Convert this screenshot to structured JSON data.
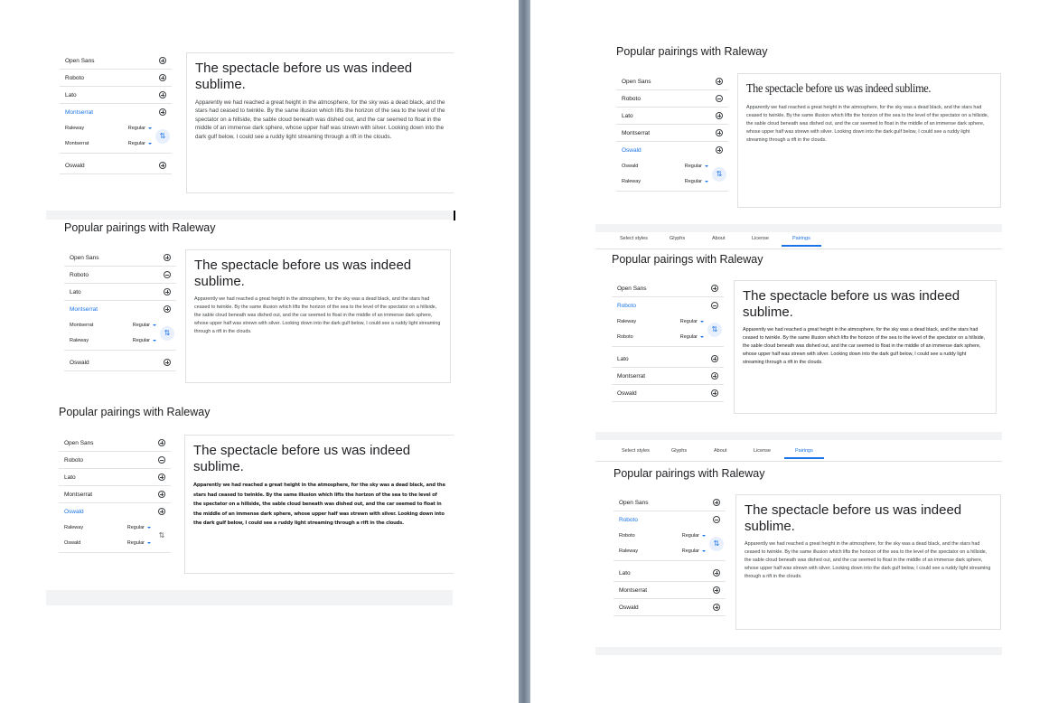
{
  "heading": "Popular pairings with Raleway",
  "preview": {
    "title": "The spectacle before us was indeed sublime.",
    "body": "Apparently we had reached a great height in the atmosphere, for the sky was a dead black, and the stars had ceased to twinkle. By the same illusion which lifts the horizon of the sea to the level of the spectator on a hillside, the sable cloud beneath was dished out, and the car seemed to float in the middle of an immense dark sphere, whose upper half was strewn with silver. Looking down into the dark gulf below, I could see a ruddy light streaming through a rift in the clouds."
  },
  "style_label": "Regular",
  "tabs": [
    "Select styles",
    "Glyphs",
    "About",
    "License",
    "Pairings"
  ],
  "active_tab": "Pairings",
  "panels": [
    {
      "fonts_before": [
        "Open Sans",
        "Roboto",
        "Lato",
        "Montserrat"
      ],
      "selected": "Montserrat",
      "sub": [
        "Raleway",
        "Montserrat"
      ],
      "fonts_after": [
        "Oswald"
      ]
    },
    {
      "fonts_before": [
        "Open Sans",
        "Roboto",
        "Lato",
        "Montserrat"
      ],
      "selected": "Montserrat",
      "sub": [
        "Montserrat",
        "Raleway"
      ],
      "fonts_after": [
        "Oswald"
      ]
    },
    {
      "fonts_before": [
        "Open Sans",
        "Roboto",
        "Lato",
        "Montserrat",
        "Oswald"
      ],
      "selected": "Oswald",
      "sub": [
        "Raleway",
        "Oswald"
      ],
      "fonts_after": []
    },
    {
      "fonts_before": [
        "Open Sans",
        "Roboto",
        "Lato",
        "Montserrat",
        "Oswald"
      ],
      "selected": "Oswald",
      "sub": [
        "Oswald",
        "Raleway"
      ],
      "fonts_after": []
    },
    {
      "fonts_before": [
        "Open Sans",
        "Roboto"
      ],
      "selected": "Roboto",
      "sub": [
        "Raleway",
        "Roboto"
      ],
      "fonts_after": [
        "Lato",
        "Montserrat",
        "Oswald"
      ]
    },
    {
      "fonts_before": [
        "Open Sans",
        "Roboto"
      ],
      "selected": "Roboto",
      "sub": [
        "Roboto",
        "Raleway"
      ],
      "fonts_after": [
        "Lato",
        "Montserrat",
        "Oswald"
      ]
    }
  ]
}
